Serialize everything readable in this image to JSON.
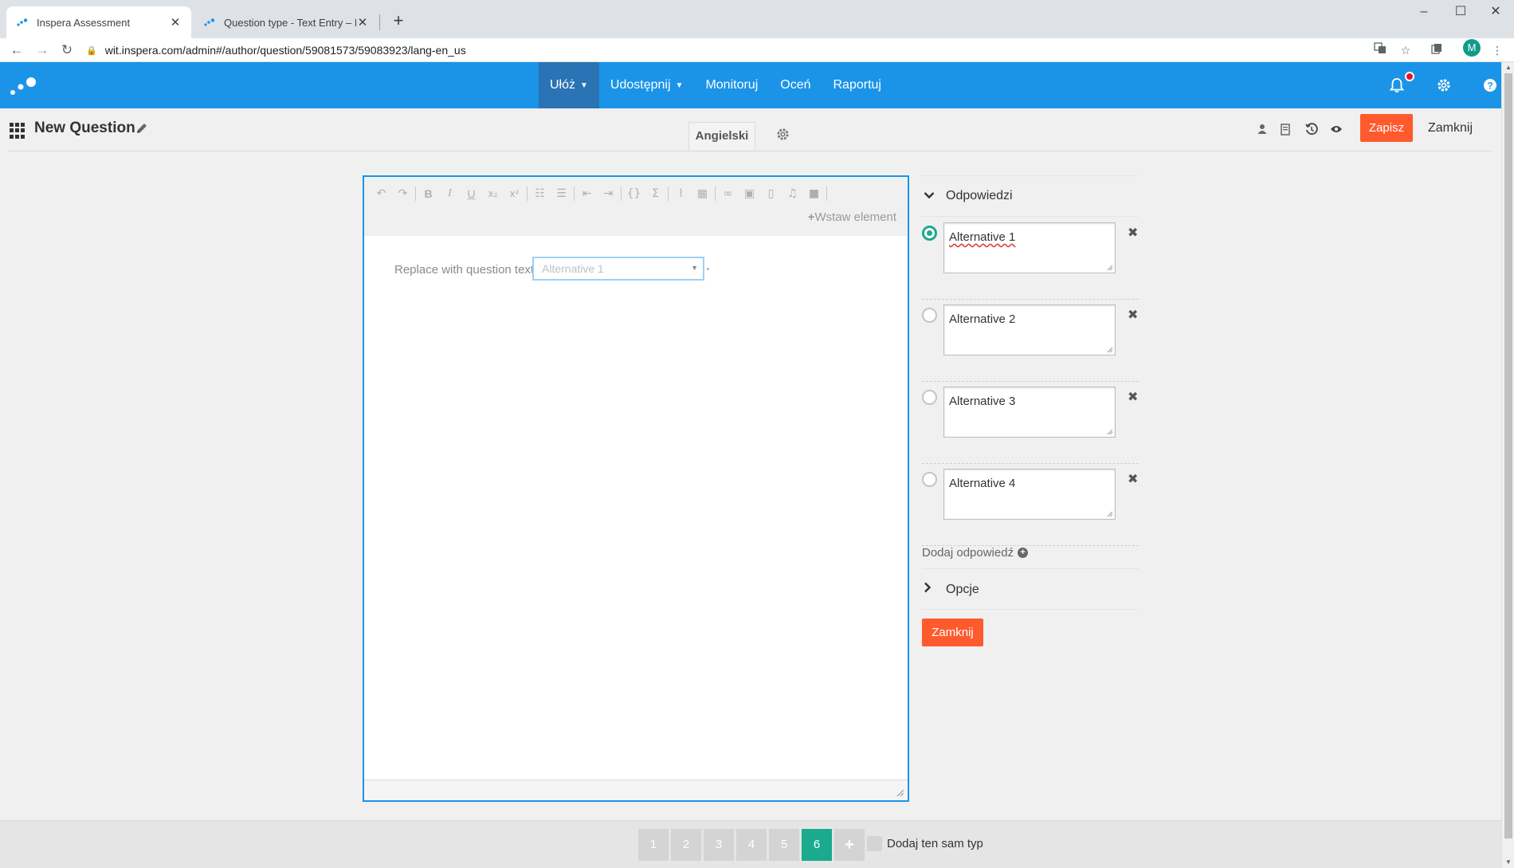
{
  "browser": {
    "tabs": [
      {
        "title": "Inspera Assessment",
        "active": true
      },
      {
        "title": "Question type - Text Entry – Insp",
        "active": false
      }
    ],
    "url": "wit.inspera.com/admin#/author/question/59081573/59083923/lang-en_us",
    "profile_initial": "M"
  },
  "appbar": {
    "nav": [
      {
        "label": "Ułóż",
        "has_dropdown": true,
        "active": true
      },
      {
        "label": "Udostępnij",
        "has_dropdown": true,
        "active": false
      },
      {
        "label": "Monitoruj",
        "has_dropdown": false,
        "active": false
      },
      {
        "label": "Oceń",
        "has_dropdown": false,
        "active": false
      },
      {
        "label": "Raportuj",
        "has_dropdown": false,
        "active": false
      }
    ]
  },
  "question_toolbar": {
    "title": "New Question",
    "language_tab": "Angielski",
    "save_label": "Zapisz",
    "close_label": "Zamknij"
  },
  "editor": {
    "insert_element_label": "Wstaw element",
    "question_text": "Replace with question text",
    "inline_dropdown_value": "Alternative 1"
  },
  "answers_panel": {
    "section_title": "Odpowiedzi",
    "alternatives": [
      {
        "text": "Alternative 1",
        "selected": true
      },
      {
        "text": "Alternative 2",
        "selected": false
      },
      {
        "text": "Alternative 3",
        "selected": false
      },
      {
        "text": "Alternative 4",
        "selected": false
      }
    ],
    "add_answer_label": "Dodaj odpowiedź",
    "options_label": "Opcje",
    "close_label": "Zamknij"
  },
  "footer": {
    "pages": [
      "1",
      "2",
      "3",
      "4",
      "5",
      "6"
    ],
    "active_page": "6",
    "add_page_label": "+",
    "same_type_label": "Dodaj ten sam typ"
  },
  "colors": {
    "brand_blue": "#1b94e8",
    "nav_active": "#2a73b4",
    "accent_orange": "#ff5a2d",
    "accent_teal": "#1aaa8d"
  }
}
